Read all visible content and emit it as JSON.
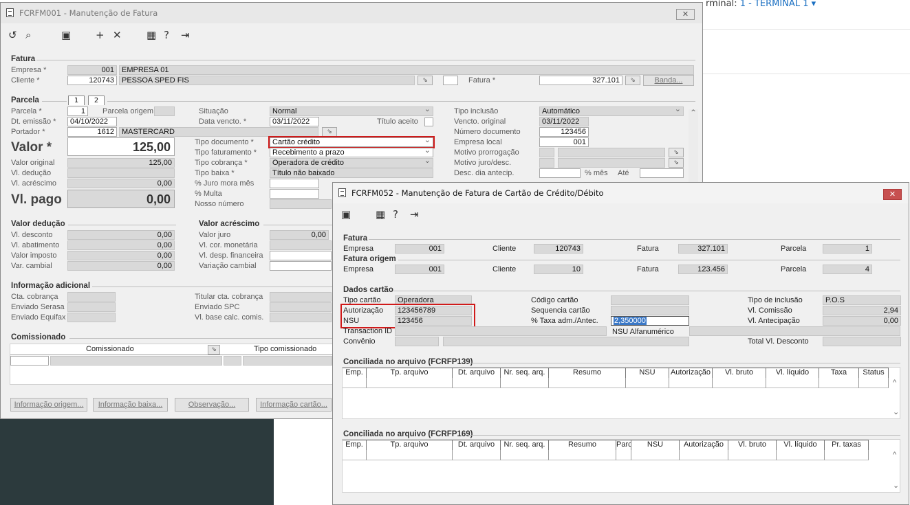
{
  "background": {
    "terminal_prefix": "rminal: ",
    "terminal_value": "1 - TERMINAL 1 ▾"
  },
  "w1": {
    "title": "FCRFM001 - Manutenção de Fatura",
    "fatura": {
      "section": "Fatura",
      "empresa_label": "Empresa *",
      "empresa_code": "001",
      "empresa_name": "EMPRESA 01",
      "cliente_label": "Cliente *",
      "cliente_code": "120743",
      "cliente_name": "PESSOA SPED FIS",
      "fatura_label": "Fatura *",
      "fatura_value": "327.101",
      "banda_button": "Banda..."
    },
    "parcela": {
      "section": "Parcela",
      "tab1": "1",
      "tab2": "2",
      "parcela_label": "Parcela *",
      "parcela_value": "1",
      "origem_label": "Parcela origem",
      "emissao_label": "Dt. emissão *",
      "emissao_value": "04/10/2022",
      "portador_label": "Portador *",
      "portador_code": "1612",
      "portador_name": "MASTERCARD",
      "valor_label": "Valor *",
      "valor_value": "125,00",
      "valor_original_label": "Valor original",
      "valor_original_value": "125,00",
      "vl_deducao_label": "Vl. dedução",
      "vl_acrescimo_label": "Vl. acréscimo",
      "vl_acrescimo_value": "0,00",
      "vl_pago_label": "Vl. pago",
      "vl_pago_value": "0,00",
      "situacao_label": "Situação",
      "situacao_value": "Normal",
      "data_vencto_label": "Data vencto. *",
      "data_vencto_value": "03/11/2022",
      "titulo_aceito_label": "Título aceito",
      "tipo_documento_label": "Tipo documento *",
      "tipo_documento_value": "Cartão crédito",
      "tipo_faturamento_label": "Tipo faturamento *",
      "tipo_faturamento_value": "Recebimento a prazo",
      "tipo_cobranca_label": "Tipo cobrança *",
      "tipo_cobranca_value": "Operadora de crédito",
      "tipo_baixa_label": "Tipo baixa *",
      "tipo_baixa_value": "Título não baixado",
      "juro_mora_label": "% Juro mora mês",
      "multa_label": "% Multa",
      "nosso_numero_label": "Nosso número",
      "tipo_inclusao_label": "Tipo inclusão",
      "tipo_inclusao_value": "Automático",
      "vencto_original_label": "Vencto. original",
      "vencto_original_value": "03/11/2022",
      "numero_documento_label": "Número documento",
      "numero_documento_value": "123456",
      "empresa_local_label": "Empresa local",
      "empresa_local_value": "001",
      "motivo_prorrogacao_label": "Motivo prorrogação",
      "motivo_juro_label": "Motivo juro/desc.",
      "desc_dia_label": "Desc. dia antecip.",
      "pct_mes_label": "% mês",
      "ate_label": "Até"
    },
    "deducao": {
      "section": "Valor dedução",
      "desconto_label": "Vl. desconto",
      "desconto_value": "0,00",
      "abatimento_label": "Vl. abatimento",
      "abatimento_value": "0,00",
      "imposto_label": "Valor imposto",
      "imposto_value": "0,00",
      "var_cambial_label": "Var. cambial",
      "var_cambial_value": "0,00"
    },
    "acrescimo": {
      "section": "Valor acréscimo",
      "juro_label": "Valor juro",
      "juro_value": "0,00",
      "cor_monetaria_label": "Vl. cor. monetária",
      "desp_financeira_label": "Vl. desp. financeira",
      "variacao_cambial_label": "Variação cambial"
    },
    "info": {
      "section": "Informação adicional",
      "cta_cobranca_label": "Cta. cobrança",
      "enviado_serasa_label": "Enviado Serasa",
      "enviado_equifax_label": "Enviado Equifax",
      "titular_label": "Titular cta. cobrança",
      "enviado_spc_label": "Enviado SPC",
      "vl_base_label": "Vl. base calc. comis."
    },
    "comissionado": {
      "section": "Comissionado",
      "col1": "Comissionado",
      "col2": "Tipo comissionado"
    },
    "buttons": {
      "origem": "Informação origem...",
      "baixa": "Informação baixa...",
      "observacao": "Observação...",
      "cartao": "Informação cartão..."
    }
  },
  "w2": {
    "title": "FCRFM052 - Manutenção de Fatura de Cartão de Crédito/Débito",
    "fatura": {
      "section": "Fatura",
      "empresa_label": "Empresa",
      "empresa_value": "001",
      "cliente_label": "Cliente",
      "cliente_value": "120743",
      "fatura_label": "Fatura",
      "fatura_value": "327.101",
      "parcela_label": "Parcela",
      "parcela_value": "1"
    },
    "origem": {
      "section": "Fatura origem",
      "empresa_label": "Empresa",
      "empresa_value": "001",
      "cliente_label": "Cliente",
      "cliente_value": "10",
      "fatura_label": "Fatura",
      "fatura_value": "123.456",
      "parcela_label": "Parcela",
      "parcela_value": "4"
    },
    "cartao": {
      "section": "Dados cartão",
      "tipo_cartao_label": "Tipo cartão",
      "tipo_cartao_value": "Operadora",
      "autorizacao_label": "Autorização",
      "autorizacao_value": "123456789",
      "nsu_label": "NSU",
      "nsu_value": "123456",
      "transaction_label": "Transaction ID",
      "convenio_label": "Convênio",
      "codigo_cartao_label": "Código cartão",
      "sequencia_label": "Sequencia cartão",
      "taxa_label": "% Taxa adm./Antec.",
      "taxa_value": "2,350000",
      "nsu_alfa_label": "NSU Alfanumérico",
      "tipo_inclusao_label": "Tipo de inclusão",
      "tipo_inclusao_value": "P.O.S",
      "comissao_label": "Vl. Comissão",
      "comissao_value": "2,94",
      "antecipacao_label": "Vl. Antecipação",
      "antecipacao_value": "0,00",
      "total_desconto_label": "Total Vl. Desconto"
    },
    "grid1": {
      "section": "Conciliada no arquivo (FCRFP139)",
      "columns": [
        "Emp.",
        "Tp. arquivo",
        "Dt. arquivo",
        "Nr. seq. arq.",
        "Resumo",
        "NSU",
        "Autorização",
        "Vl. bruto",
        "Vl. líquido",
        "Taxa",
        "Status"
      ]
    },
    "grid2": {
      "section": "Conciliada no arquivo (FCRFP169)",
      "columns": [
        "Emp.",
        "Tp. arquivo",
        "Dt. arquivo",
        "Nr. seq. arq.",
        "Resumo",
        "Parc.",
        "NSU",
        "Autorização",
        "Vl. bruto",
        "Vl. líquido",
        "Pr. taxas"
      ]
    }
  }
}
